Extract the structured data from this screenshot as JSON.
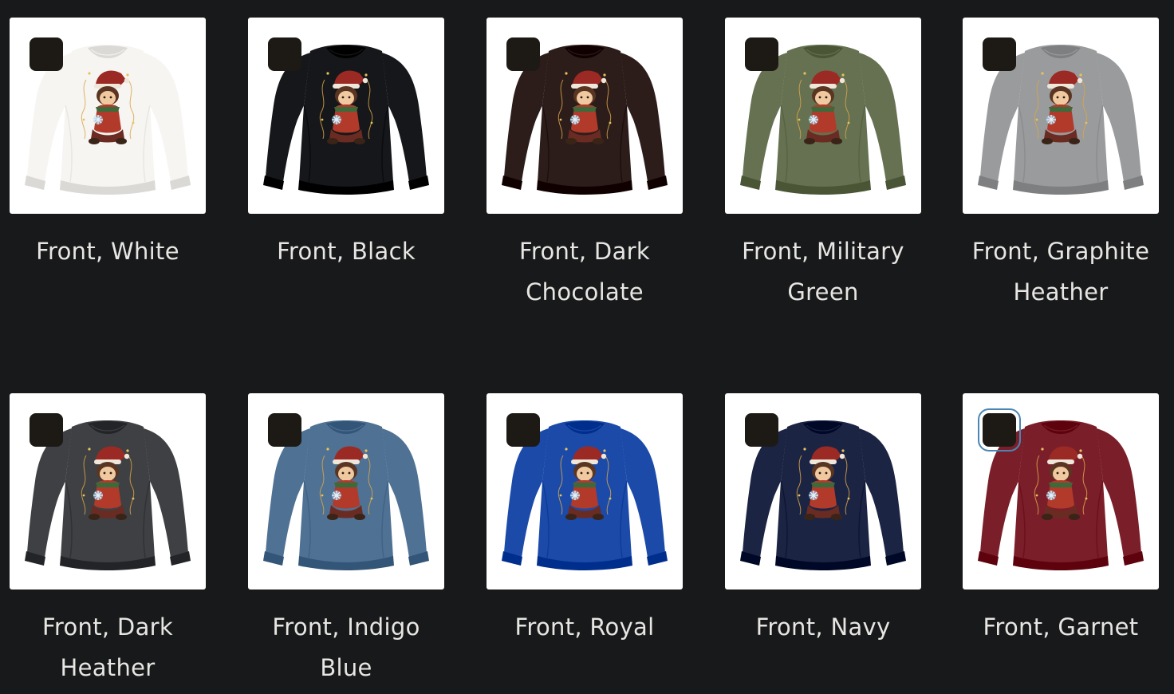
{
  "variants": [
    {
      "label": "Front, White",
      "color": "#f6f5f2",
      "selected": false
    },
    {
      "label": "Front, Black",
      "color": "#15171a",
      "selected": false
    },
    {
      "label": "Front, Dark Chocolate",
      "color": "#2c1d1b",
      "selected": false
    },
    {
      "label": "Front, Military Green",
      "color": "#657150",
      "selected": false
    },
    {
      "label": "Front, Graphite Heather",
      "color": "#9a9b9d",
      "selected": false
    },
    {
      "label": "Front, Dark Heather",
      "color": "#3e4043",
      "selected": false
    },
    {
      "label": "Front, Indigo Blue",
      "color": "#4f7193",
      "selected": false
    },
    {
      "label": "Front, Royal",
      "color": "#1b4aa9",
      "selected": false
    },
    {
      "label": "Front, Navy",
      "color": "#1c2443",
      "selected": false
    },
    {
      "label": "Front, Garnet",
      "color": "#7a1f2a",
      "selected": true
    }
  ],
  "icons": {
    "checkbox": "checkbox-icon",
    "sweatshirt": "sweatshirt-icon",
    "print_design": "elf-santa-hat-design"
  },
  "colors": {
    "background": "#18191b",
    "label_text": "#e7e6e2",
    "checkbox_fill": "#1d1a15",
    "focus_ring": "#4a86b4"
  }
}
